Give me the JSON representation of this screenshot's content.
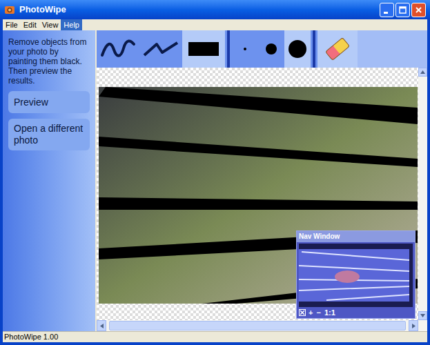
{
  "window": {
    "title": "PhotoWipe"
  },
  "menu": [
    {
      "label": "File",
      "selected": false
    },
    {
      "label": "Edit",
      "selected": false
    },
    {
      "label": "View",
      "selected": false
    },
    {
      "label": "Help",
      "selected": true
    }
  ],
  "sidebar": {
    "instructions": "Remove objects from your photo by painting them black. Then preview the results.",
    "buttons": [
      "Preview",
      "Open a different photo"
    ]
  },
  "toolbar": {
    "tools": [
      {
        "kind": "freehand",
        "selected": false
      },
      {
        "kind": "line",
        "selected": false
      },
      {
        "kind": "rectangle",
        "selected": true
      }
    ],
    "sizes": [
      {
        "kind": "small",
        "selected": false
      },
      {
        "kind": "medium",
        "selected": false
      },
      {
        "kind": "large",
        "selected": true
      }
    ],
    "eraser": {
      "selected": true
    }
  },
  "nav_window": {
    "title": "Nav Window",
    "buttons": [
      "+",
      "−",
      "1:1"
    ]
  },
  "status_bar": "PhotoWipe 1.00"
}
